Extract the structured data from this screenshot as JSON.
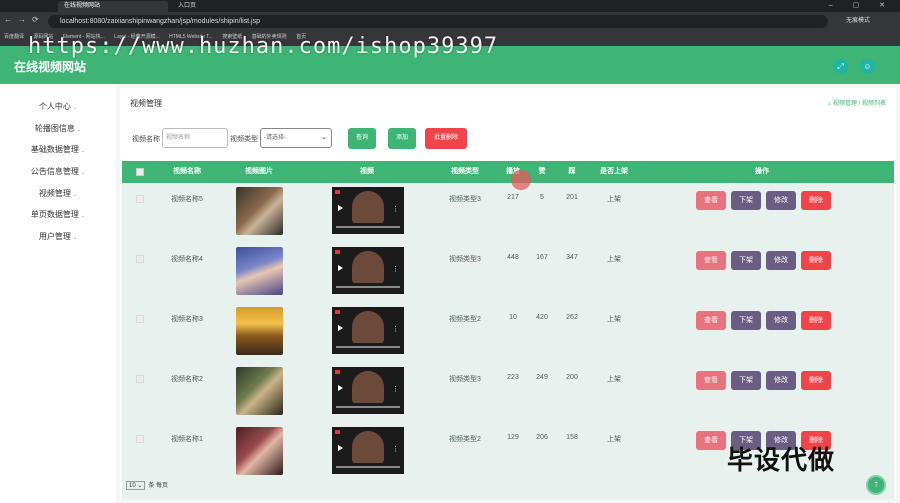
{
  "browser": {
    "tabs": [
      "在线视频网站",
      "入口页"
    ],
    "url": "localhost:8080/zaixianshipinwangzhan/jsp/modules/shipin/list.jsp",
    "profile_label": "无痕模式",
    "bookmarks": [
      "百度翻译",
      "源码网站",
      "Element - 网站快...",
      "Layui - 经典开源模...",
      "HTML5 Website T...",
      "搜索壁纸",
      "基础的外卖规则",
      "首页"
    ]
  },
  "watermark": "https://www.huzhan.com/ishop39397",
  "header": {
    "title": "在线视频网站"
  },
  "sidebar": {
    "items": [
      {
        "label": "个人中心"
      },
      {
        "label": "轮播图信息"
      },
      {
        "label": "基础数据管理"
      },
      {
        "label": "公告信息管理"
      },
      {
        "label": "视频管理"
      },
      {
        "label": "单页数据管理"
      },
      {
        "label": "用户管理"
      }
    ]
  },
  "page": {
    "title": "视频管理",
    "breadcrumb": "视频管理 / 视频列表"
  },
  "filter": {
    "name_label": "视频名称",
    "name_placeholder": "视频名称",
    "type_label": "视频类型",
    "type_value": "-请选择-",
    "search_label": "查询",
    "add_label": "添加",
    "batch_delete_label": "批量删除"
  },
  "table": {
    "columns": [
      "视频名称",
      "视频图片",
      "视频",
      "视频类型",
      "播放",
      "赞",
      "踩",
      "是否上架",
      "操作"
    ],
    "rows": [
      {
        "name": "视频名称5",
        "type": "视频类型3",
        "plays": "217",
        "likes": "5",
        "dislikes": "201",
        "status": "上架"
      },
      {
        "name": "视频名称4",
        "type": "视频类型3",
        "plays": "448",
        "likes": "167",
        "dislikes": "347",
        "status": "上架"
      },
      {
        "name": "视频名称3",
        "type": "视频类型2",
        "plays": "10",
        "likes": "420",
        "dislikes": "262",
        "status": "上架"
      },
      {
        "name": "视频名称2",
        "type": "视频类型3",
        "plays": "223",
        "likes": "249",
        "dislikes": "200",
        "status": "上架"
      },
      {
        "name": "视频名称1",
        "type": "视频类型2",
        "plays": "129",
        "likes": "206",
        "dislikes": "158",
        "status": "上架"
      }
    ],
    "actions": {
      "view": "查看",
      "down": "下架",
      "edit": "修改",
      "delete": "删除"
    }
  },
  "pager": {
    "page_size": "10",
    "suffix": "条 每页"
  },
  "overlay_text": "毕设代做",
  "colors": {
    "primary": "#3eb575",
    "danger": "#f0434a",
    "purple": "#6b5d82",
    "pink": "#e8737e"
  }
}
